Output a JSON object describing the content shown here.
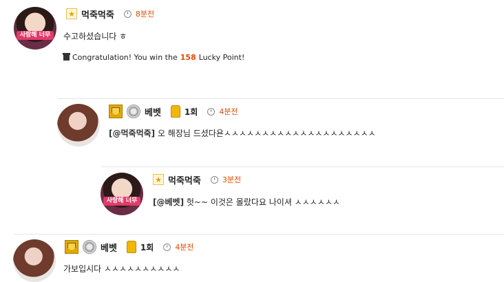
{
  "comments": [
    {
      "author": "먹죽먹죽",
      "time": "8분전",
      "avatar_tag": "사랑해 너무",
      "text": "수고하셨습니다 ㅎ",
      "lucky": {
        "prefix": "Congratulation! You win the ",
        "points": "158",
        "suffix": " Lucky Point!"
      }
    },
    {
      "author": "베벳",
      "count": "1회",
      "time": "4분전",
      "mention": "[@먹죽먹죽]",
      "text": " 오 해장님 드셨다욘ㅅㅅㅅㅅㅅㅅㅅㅅㅅㅅㅅㅅㅅㅅㅅㅅㅅㅅㅅㅅ"
    },
    {
      "author": "먹죽먹죽",
      "time": "3분전",
      "avatar_tag": "사랑해 너무",
      "mention": "[@베벳]",
      "text": " 헛~~ 이것은 몰랐다요 나이셔 ㅅㅅㅅㅅㅅㅅ"
    },
    {
      "author": "베벳",
      "count": "1회",
      "time": "4분전",
      "text": "가보입시다 ㅅㅅㅅㅅㅅㅅㅅㅅㅅㅅ"
    }
  ],
  "colors": {
    "time": "#e34a00",
    "points": "#e34a00",
    "divider": "#e6e6e6"
  }
}
